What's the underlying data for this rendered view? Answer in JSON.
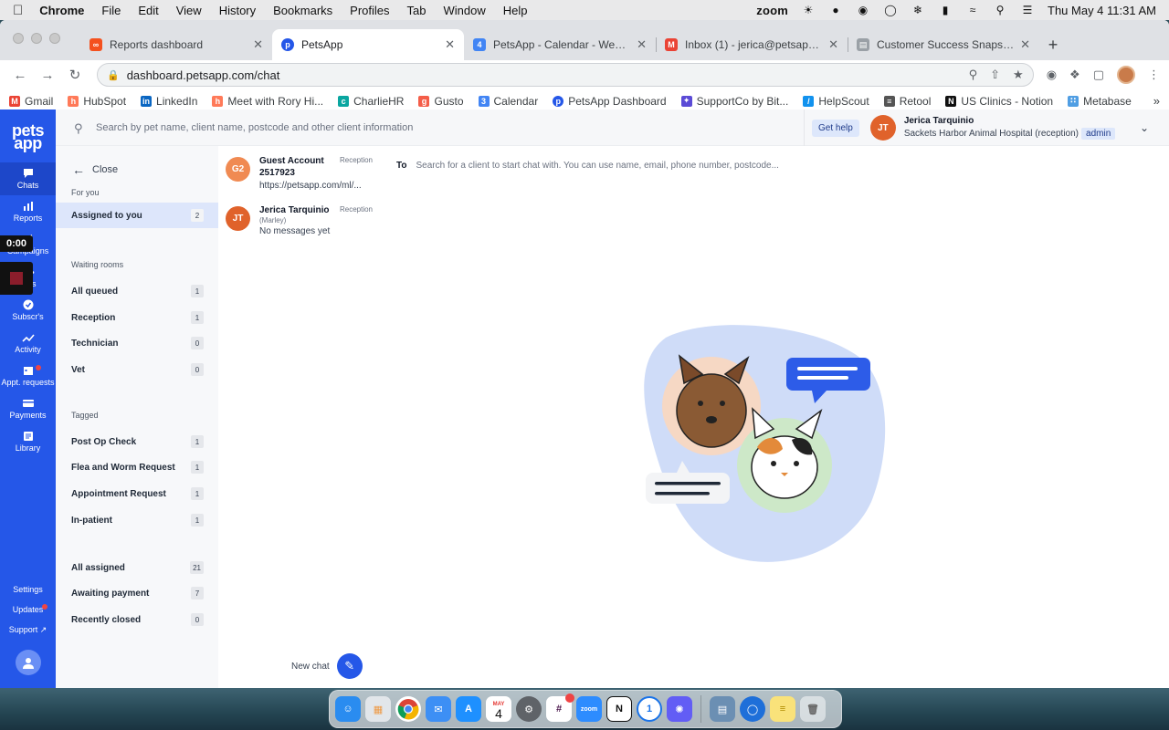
{
  "menubar": {
    "app_name": "Chrome",
    "items": [
      "File",
      "Edit",
      "View",
      "History",
      "Bookmarks",
      "Profiles",
      "Tab",
      "Window",
      "Help"
    ],
    "zoom_label": "zoom",
    "clock": "Thu May 4  11:31 AM"
  },
  "browser": {
    "tabs": [
      {
        "title": "Reports dashboard",
        "color": "#f4511e"
      },
      {
        "title": "PetsApp",
        "color": "#2557e8",
        "active": true
      },
      {
        "title": "PetsApp - Calendar - Week of",
        "color": "#4285f4"
      },
      {
        "title": "Inbox (1) - jerica@petsapp.com",
        "color": "#ea4335"
      },
      {
        "title": "Customer Success Snapshot",
        "color": "#9aa0a6"
      }
    ],
    "url": "dashboard.petsapp.com/chat",
    "bookmarks": [
      {
        "label": "Gmail",
        "color": "#ea4335"
      },
      {
        "label": "HubSpot",
        "color": "#ff7a59"
      },
      {
        "label": "LinkedIn",
        "color": "#0a66c2"
      },
      {
        "label": "Meet with Rory Hi...",
        "color": "#ff7a59"
      },
      {
        "label": "CharlieHR",
        "color": "#0aa6a0"
      },
      {
        "label": "Gusto",
        "color": "#f45d48"
      },
      {
        "label": "Calendar",
        "color": "#4285f4"
      },
      {
        "label": "PetsApp Dashboard",
        "color": "#2557e8"
      },
      {
        "label": "SupportCo by Bit...",
        "color": "#5b4bd6"
      },
      {
        "label": "HelpScout",
        "color": "#1292ee"
      },
      {
        "label": "Retool",
        "color": "#555555"
      },
      {
        "label": "US Clinics - Notion",
        "color": "#111111"
      },
      {
        "label": "Metabase",
        "color": "#509ee3"
      }
    ],
    "more_bookmarks": "»"
  },
  "overlay": {
    "timer": "0:00"
  },
  "leftnav": {
    "logo_line1": "pets",
    "logo_line2": "app",
    "items": [
      {
        "label": "Chats",
        "icon": "chat-icon"
      },
      {
        "label": "Reports",
        "icon": "reports-icon"
      },
      {
        "label": "Campaigns",
        "icon": "campaigns-icon"
      },
      {
        "label": "Pets",
        "icon": "paw-icon"
      },
      {
        "label": "Subscr's",
        "icon": "check-badge-icon"
      },
      {
        "label": "Activity",
        "icon": "trend-icon"
      },
      {
        "label": "Appt. requests",
        "icon": "calendar-icon"
      },
      {
        "label": "Payments",
        "icon": "card-icon"
      },
      {
        "label": "Library",
        "icon": "library-icon"
      }
    ],
    "bottom": {
      "settings": "Settings",
      "updates": "Updates",
      "support": "Support"
    }
  },
  "topbar": {
    "search_placeholder": "Search by pet name, client name, postcode and other client information",
    "get_help": "Get help",
    "user_initials": "JT",
    "user_name": "Jerica Tarquinio",
    "user_org": "Sackets Harbor Animal Hospital (reception)",
    "user_role": "admin"
  },
  "inbox": {
    "close_label": "Close",
    "for_you_label": "For you",
    "assigned_to_you": {
      "label": "Assigned to you",
      "count": "2"
    },
    "waiting_rooms_label": "Waiting rooms",
    "waiting_rooms": [
      {
        "label": "All queued",
        "count": "1"
      },
      {
        "label": "Reception",
        "count": "1"
      },
      {
        "label": "Technician",
        "count": "0"
      },
      {
        "label": "Vet",
        "count": "0"
      }
    ],
    "tagged_label": "Tagged",
    "tagged": [
      {
        "label": "Post Op Check",
        "count": "1"
      },
      {
        "label": "Flea and Worm Request",
        "count": "1"
      },
      {
        "label": "Appointment Request",
        "count": "1"
      },
      {
        "label": "In-patient",
        "count": "1"
      }
    ],
    "summary": [
      {
        "label": "All assigned",
        "count": "21"
      },
      {
        "label": "Awaiting payment",
        "count": "7"
      },
      {
        "label": "Recently closed",
        "count": "0"
      }
    ]
  },
  "conversations": [
    {
      "initials": "G2",
      "name": "Guest Account 2517923",
      "queue": "Reception",
      "sub": "",
      "preview": "https://petsapp.com/ml/...",
      "color": "#f08a52"
    },
    {
      "initials": "JT",
      "name": "Jerica Tarquinio",
      "queue": "Reception",
      "sub": "(Marley)",
      "preview": "No messages yet",
      "color": "#e0622b"
    }
  ],
  "new_chat_label": "New chat",
  "chat": {
    "to_label": "To",
    "to_placeholder": "Search for a client to start chat with. You can use name, email, phone number, postcode..."
  },
  "dock": {
    "calendar_month": "MAY",
    "calendar_day": "4",
    "zoom_label": "zoom",
    "apps": [
      {
        "icon": "finder-icon",
        "color": "#2a8cf0"
      },
      {
        "icon": "launchpad-icon",
        "color": "#e2e6ea"
      },
      {
        "icon": "chrome-icon",
        "color": "#ffffff"
      },
      {
        "icon": "mail-icon",
        "color": "#3d8ff5"
      },
      {
        "icon": "app-store-icon",
        "color": "#1e90ff"
      },
      {
        "icon": "calendar-icon",
        "color": "#ffffff"
      },
      {
        "icon": "system-preferences-icon",
        "color": "#5f6368"
      },
      {
        "icon": "slack-icon",
        "color": "#ffffff"
      },
      {
        "icon": "zoom-icon",
        "color": "#2d8cff"
      },
      {
        "icon": "notion-icon",
        "color": "#ffffff"
      },
      {
        "icon": "1password-icon",
        "color": "#ffffff"
      },
      {
        "icon": "loom-icon",
        "color": "#625df5"
      }
    ]
  }
}
